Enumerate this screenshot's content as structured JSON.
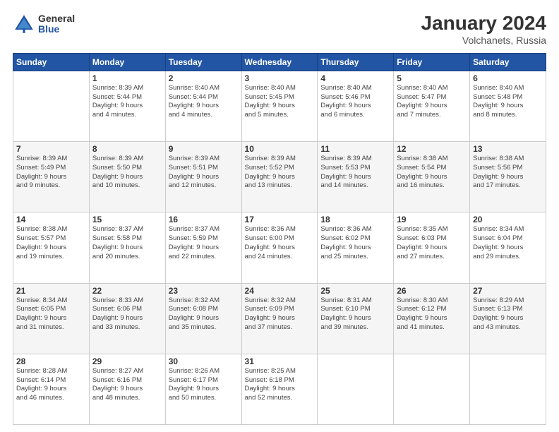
{
  "logo": {
    "general": "General",
    "blue": "Blue"
  },
  "header": {
    "title": "January 2024",
    "location": "Volchanets, Russia"
  },
  "weekdays": [
    "Sunday",
    "Monday",
    "Tuesday",
    "Wednesday",
    "Thursday",
    "Friday",
    "Saturday"
  ],
  "weeks": [
    [
      {
        "day": "",
        "info": ""
      },
      {
        "day": "1",
        "info": "Sunrise: 8:39 AM\nSunset: 5:44 PM\nDaylight: 9 hours\nand 4 minutes."
      },
      {
        "day": "2",
        "info": "Sunrise: 8:40 AM\nSunset: 5:44 PM\nDaylight: 9 hours\nand 4 minutes."
      },
      {
        "day": "3",
        "info": "Sunrise: 8:40 AM\nSunset: 5:45 PM\nDaylight: 9 hours\nand 5 minutes."
      },
      {
        "day": "4",
        "info": "Sunrise: 8:40 AM\nSunset: 5:46 PM\nDaylight: 9 hours\nand 6 minutes."
      },
      {
        "day": "5",
        "info": "Sunrise: 8:40 AM\nSunset: 5:47 PM\nDaylight: 9 hours\nand 7 minutes."
      },
      {
        "day": "6",
        "info": "Sunrise: 8:40 AM\nSunset: 5:48 PM\nDaylight: 9 hours\nand 8 minutes."
      }
    ],
    [
      {
        "day": "7",
        "info": "Sunrise: 8:39 AM\nSunset: 5:49 PM\nDaylight: 9 hours\nand 9 minutes."
      },
      {
        "day": "8",
        "info": "Sunrise: 8:39 AM\nSunset: 5:50 PM\nDaylight: 9 hours\nand 10 minutes."
      },
      {
        "day": "9",
        "info": "Sunrise: 8:39 AM\nSunset: 5:51 PM\nDaylight: 9 hours\nand 12 minutes."
      },
      {
        "day": "10",
        "info": "Sunrise: 8:39 AM\nSunset: 5:52 PM\nDaylight: 9 hours\nand 13 minutes."
      },
      {
        "day": "11",
        "info": "Sunrise: 8:39 AM\nSunset: 5:53 PM\nDaylight: 9 hours\nand 14 minutes."
      },
      {
        "day": "12",
        "info": "Sunrise: 8:38 AM\nSunset: 5:54 PM\nDaylight: 9 hours\nand 16 minutes."
      },
      {
        "day": "13",
        "info": "Sunrise: 8:38 AM\nSunset: 5:56 PM\nDaylight: 9 hours\nand 17 minutes."
      }
    ],
    [
      {
        "day": "14",
        "info": "Sunrise: 8:38 AM\nSunset: 5:57 PM\nDaylight: 9 hours\nand 19 minutes."
      },
      {
        "day": "15",
        "info": "Sunrise: 8:37 AM\nSunset: 5:58 PM\nDaylight: 9 hours\nand 20 minutes."
      },
      {
        "day": "16",
        "info": "Sunrise: 8:37 AM\nSunset: 5:59 PM\nDaylight: 9 hours\nand 22 minutes."
      },
      {
        "day": "17",
        "info": "Sunrise: 8:36 AM\nSunset: 6:00 PM\nDaylight: 9 hours\nand 24 minutes."
      },
      {
        "day": "18",
        "info": "Sunrise: 8:36 AM\nSunset: 6:02 PM\nDaylight: 9 hours\nand 25 minutes."
      },
      {
        "day": "19",
        "info": "Sunrise: 8:35 AM\nSunset: 6:03 PM\nDaylight: 9 hours\nand 27 minutes."
      },
      {
        "day": "20",
        "info": "Sunrise: 8:34 AM\nSunset: 6:04 PM\nDaylight: 9 hours\nand 29 minutes."
      }
    ],
    [
      {
        "day": "21",
        "info": "Sunrise: 8:34 AM\nSunset: 6:05 PM\nDaylight: 9 hours\nand 31 minutes."
      },
      {
        "day": "22",
        "info": "Sunrise: 8:33 AM\nSunset: 6:06 PM\nDaylight: 9 hours\nand 33 minutes."
      },
      {
        "day": "23",
        "info": "Sunrise: 8:32 AM\nSunset: 6:08 PM\nDaylight: 9 hours\nand 35 minutes."
      },
      {
        "day": "24",
        "info": "Sunrise: 8:32 AM\nSunset: 6:09 PM\nDaylight: 9 hours\nand 37 minutes."
      },
      {
        "day": "25",
        "info": "Sunrise: 8:31 AM\nSunset: 6:10 PM\nDaylight: 9 hours\nand 39 minutes."
      },
      {
        "day": "26",
        "info": "Sunrise: 8:30 AM\nSunset: 6:12 PM\nDaylight: 9 hours\nand 41 minutes."
      },
      {
        "day": "27",
        "info": "Sunrise: 8:29 AM\nSunset: 6:13 PM\nDaylight: 9 hours\nand 43 minutes."
      }
    ],
    [
      {
        "day": "28",
        "info": "Sunrise: 8:28 AM\nSunset: 6:14 PM\nDaylight: 9 hours\nand 46 minutes."
      },
      {
        "day": "29",
        "info": "Sunrise: 8:27 AM\nSunset: 6:16 PM\nDaylight: 9 hours\nand 48 minutes."
      },
      {
        "day": "30",
        "info": "Sunrise: 8:26 AM\nSunset: 6:17 PM\nDaylight: 9 hours\nand 50 minutes."
      },
      {
        "day": "31",
        "info": "Sunrise: 8:25 AM\nSunset: 6:18 PM\nDaylight: 9 hours\nand 52 minutes."
      },
      {
        "day": "",
        "info": ""
      },
      {
        "day": "",
        "info": ""
      },
      {
        "day": "",
        "info": ""
      }
    ]
  ]
}
